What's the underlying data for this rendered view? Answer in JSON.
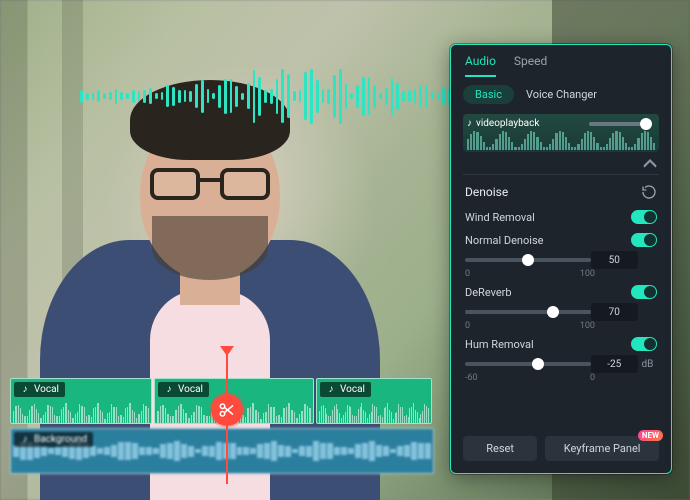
{
  "panel": {
    "tabs": {
      "audio": "Audio",
      "speed": "Speed",
      "active": "audio"
    },
    "subtabs": {
      "basic": "Basic",
      "voice_changer": "Voice Changer"
    },
    "clip_name": "videoplayback",
    "denoise": {
      "title": "Denoise",
      "wind_removal": {
        "label": "Wind Removal",
        "on": true
      },
      "normal": {
        "label": "Normal Denoise",
        "on": true,
        "value": 50,
        "min": 0,
        "max": 100
      },
      "dereverb": {
        "label": "DeReverb",
        "on": true,
        "value": 70,
        "min": 0,
        "max": 100
      },
      "hum": {
        "label": "Hum Removal",
        "on": true,
        "value": -25.0,
        "unit": "dB",
        "min": -60,
        "max": 0
      }
    },
    "footer": {
      "reset": "Reset",
      "keyframe": "Keyframe Panel",
      "badge": "NEW"
    }
  },
  "timeline": {
    "vocal_label": "Vocal",
    "background_label": "Background"
  }
}
